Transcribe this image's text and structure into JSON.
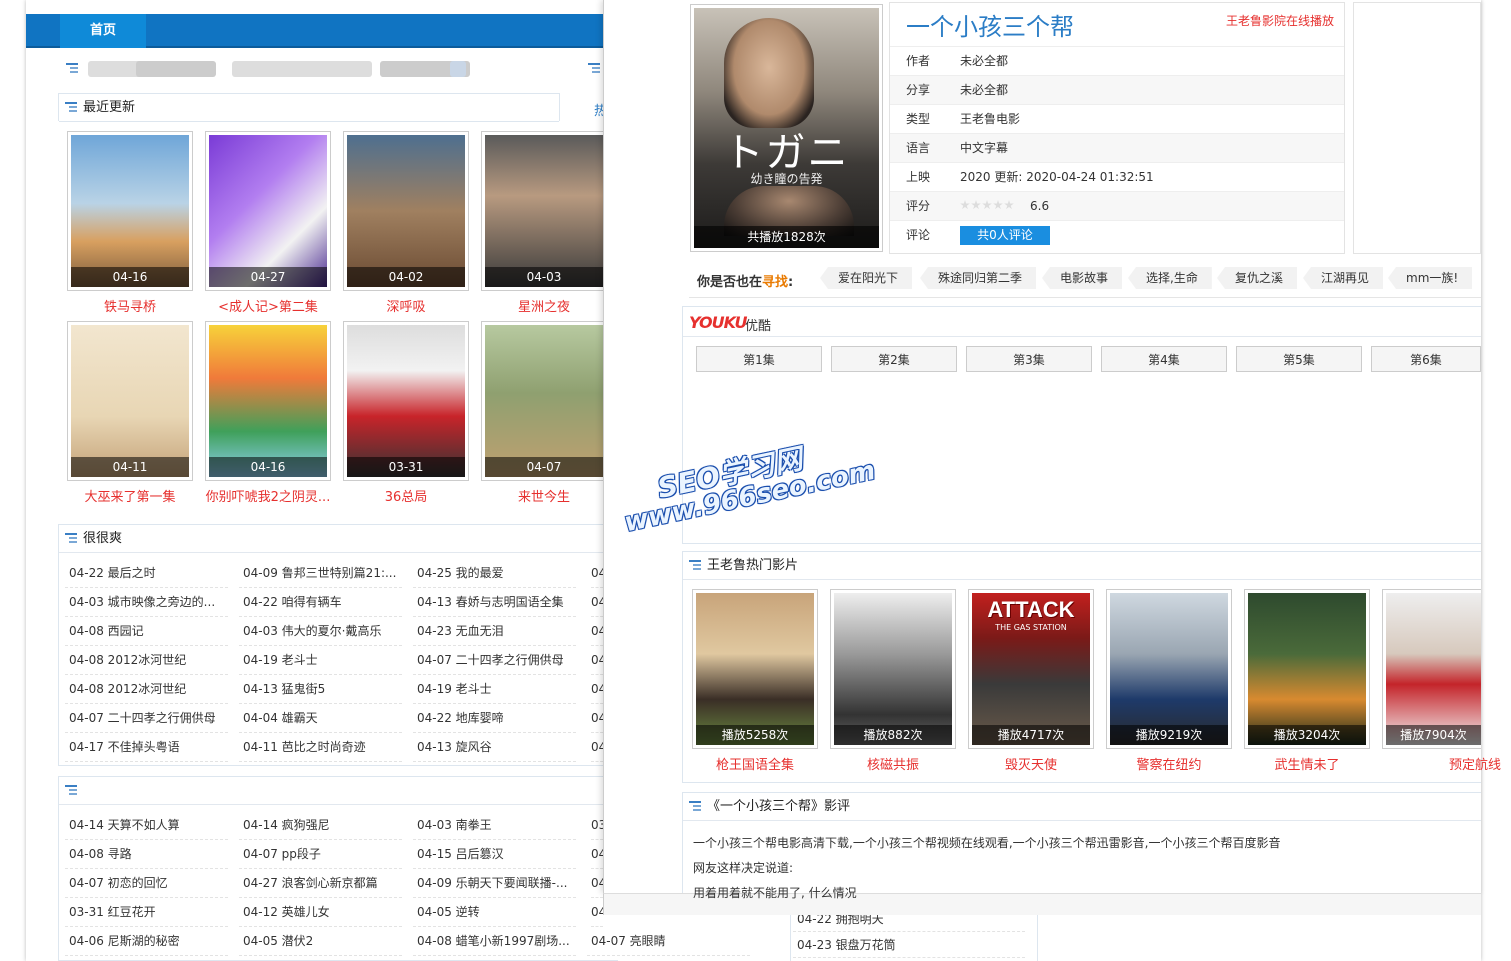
{
  "nav": {
    "home_label": "首页"
  },
  "recent": {
    "title": "最近更新",
    "hot_fragment": "热",
    "items": [
      {
        "date": "04-16",
        "title": "铁马寻桥"
      },
      {
        "date": "04-27",
        "title": "<成人记>第二集"
      },
      {
        "date": "04-02",
        "title": "深呼吸"
      },
      {
        "date": "04-03",
        "title": "星洲之夜"
      },
      {
        "date": "04-11",
        "title": "大巫来了第一集"
      },
      {
        "date": "04-16",
        "title": "你别吓唬我2之阴灵..."
      },
      {
        "date": "03-31",
        "title": "36总局"
      },
      {
        "date": "04-07",
        "title": "来世今生"
      }
    ]
  },
  "henhenshuang": {
    "title": "很很爽",
    "col_fragment": "04",
    "rows": [
      [
        "04-22 最后之时",
        "04-09 鲁邦三世特别篇21:...",
        "04-25 我的最爱"
      ],
      [
        "04-03 城市映像之旁边的...",
        "04-22 咱得有辆车",
        "04-13 春娇与志明国语全集"
      ],
      [
        "04-08 西园记",
        "04-03 伟大的夏尔·戴高乐",
        "04-23 无血无泪"
      ],
      [
        "04-08 2012冰河世纪",
        "04-19 老斗士",
        "04-07 二十四孝之行佣供母"
      ],
      [
        "04-08 2012冰河世纪",
        "04-13 猛鬼街5",
        "04-19 老斗士"
      ],
      [
        "04-07 二十四孝之行佣供母",
        "04-04 雄霸天",
        "04-22 地库婴啼"
      ],
      [
        "04-17 不佳掉头粤语",
        "04-11 芭比之时尚奇迹",
        "04-13 旋风谷"
      ]
    ]
  },
  "third": {
    "col_fragment": "03",
    "col_fragment2": "04",
    "rows": [
      [
        "04-14 天算不如人算",
        "04-14 疯狗强尼",
        "04-03 南拳王"
      ],
      [
        "04-08 寻路",
        "04-07 pp段子",
        "04-15 吕后篡汉"
      ],
      [
        "04-07 初恋的回忆",
        "04-27 浪客剑心新京都篇",
        "04-09 乐朝天下要闻联播-..."
      ],
      [
        "03-31 红豆花开",
        "04-12 英雄儿女",
        "04-05 逆转"
      ],
      [
        "04-06 尼斯湖的秘密",
        "04-05 潜伏2",
        "04-08 蜡笔小新1997剧场..."
      ]
    ],
    "col4_last": "04-07 亮眼睛",
    "extra_rows": [
      "04-22 拥抱明天",
      "04-23 银盘万花筒"
    ]
  },
  "movie": {
    "title": "一个小孩三个帮",
    "online_link": "王老鲁影院在线播放",
    "poster_caption": "共播放1828次",
    "poster_text": "トガニ",
    "poster_subtext": "幼き瞳の告発",
    "info": [
      {
        "key": "作者",
        "value": "未必全都"
      },
      {
        "key": "分享",
        "value": "未必全都"
      },
      {
        "key": "类型",
        "value": "王老鲁电影"
      },
      {
        "key": "语言",
        "value": "中文字幕"
      },
      {
        "key": "上映",
        "value": "2020  更新: 2020-04-24 01:32:51"
      },
      {
        "key": "评分",
        "value": "6.6"
      },
      {
        "key": "评论",
        "value": ""
      }
    ],
    "comment_button": "共0人评论",
    "rating": 0
  },
  "search": {
    "label_prefix": "你是否也在",
    "label_highlight": "寻找",
    "label_suffix": ":",
    "tags": [
      "爱在阳光下",
      "殊途同归第二季",
      "电影故事",
      "选择,生命",
      "复仇之溪",
      "江湖再见",
      "mm一族!"
    ]
  },
  "youku": {
    "logo": "YOUKU",
    "name": "优酷",
    "episodes": [
      "第1集",
      "第2集",
      "第3集",
      "第4集",
      "第5集",
      "第6集"
    ]
  },
  "watermark": {
    "line1": "SEO学习网",
    "line2": "www.966seo.com"
  },
  "hot": {
    "title": "王老鲁热门影片",
    "items": [
      {
        "caption": "播放5258次",
        "title": "枪王国语全集"
      },
      {
        "caption": "播放882次",
        "title": "核磁共振"
      },
      {
        "caption": "播放4717次",
        "title": "毁灭天使"
      },
      {
        "caption": "播放9219次",
        "title": "警察在纽约"
      },
      {
        "caption": "播放3204次",
        "title": "武生情未了"
      },
      {
        "caption": "播放7904次",
        "title": "预定航线"
      }
    ],
    "attack_text": "ATTACK",
    "attack_sub": "THE GAS STATION"
  },
  "review": {
    "title": "《一个小孩三个帮》影评",
    "lines": [
      "一个小孩三个帮电影高清下载,一个小孩三个帮视频在线观看,一个小孩三个帮迅雷影音,一个小孩三个帮百度影音",
      "网友这样决定说道:",
      "用着用着就不能用了, 什么情况"
    ]
  },
  "colors": {
    "accent": "#1074c2",
    "red": "#e6302e",
    "orange": "#e97a00",
    "blue_title": "#2b7dc6"
  }
}
